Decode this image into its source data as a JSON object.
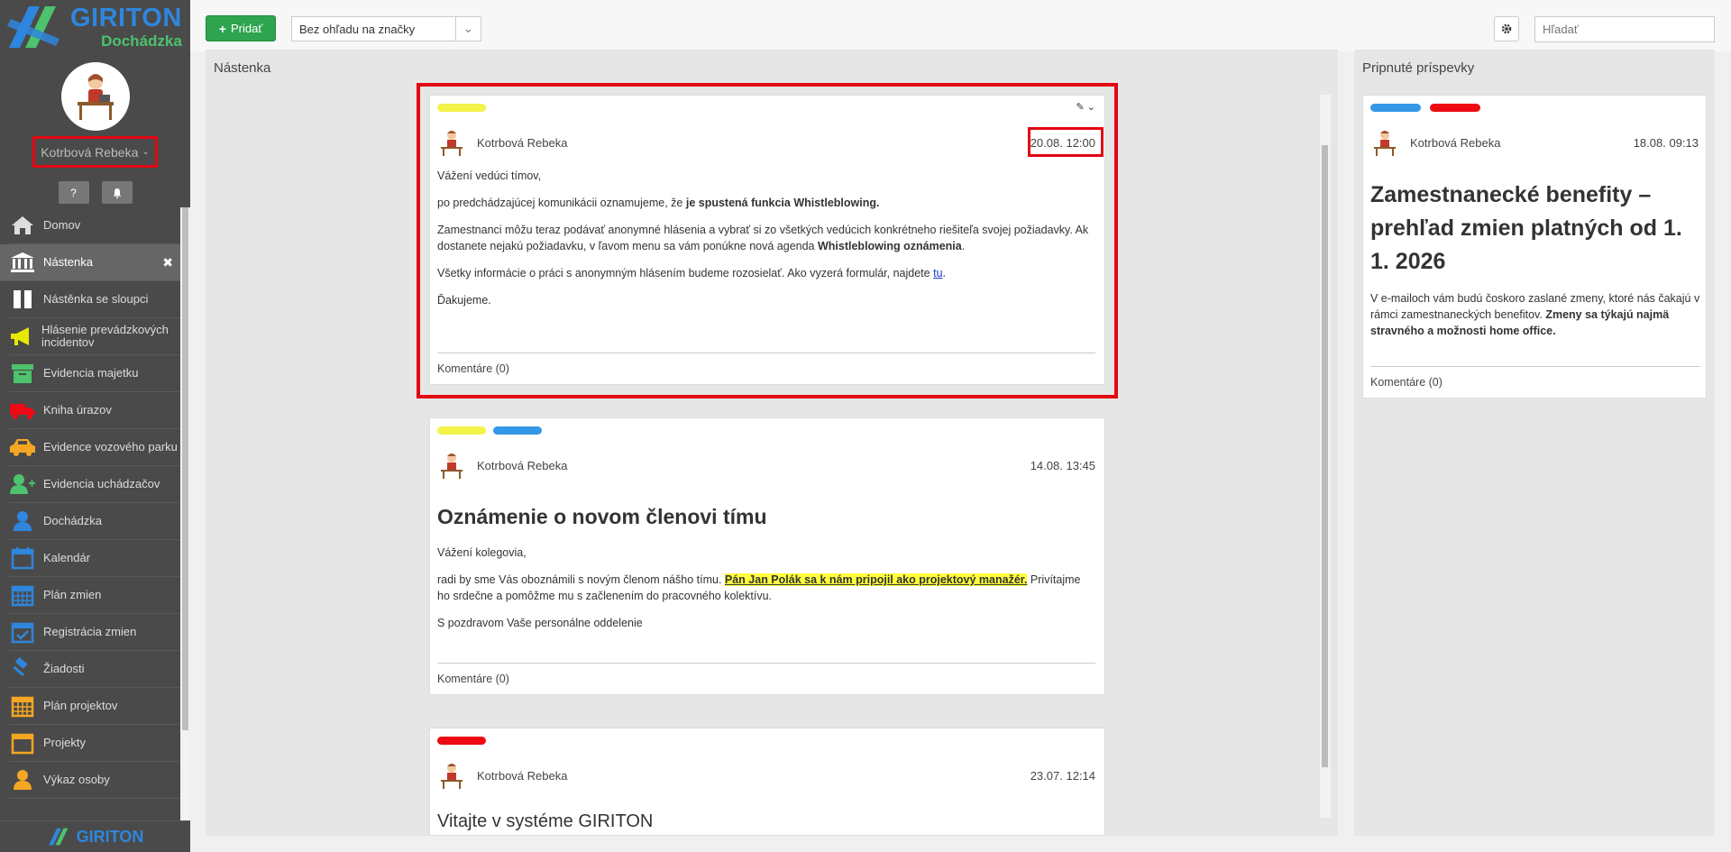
{
  "app": {
    "brand": "GIRITON",
    "subtitle": "Dochádzka",
    "footer_brand": "GIRITON"
  },
  "colors": {
    "sidebar_bg": "#4a4a4a",
    "primary": "#2e86de",
    "success": "#2ea44f",
    "highlight": "#e30613",
    "tag_yellow": "#f3f34a",
    "tag_blue": "#3399e6",
    "tag_red": "#ee0a14"
  },
  "user": {
    "name": "Kotrbová Rebeka"
  },
  "sidebar": {
    "items": [
      {
        "label": "Domov",
        "icon": "home-icon"
      },
      {
        "label": "Nástenka",
        "icon": "bank-icon",
        "active": true
      },
      {
        "label": "Nástěnka se sloupci",
        "icon": "columns-icon"
      },
      {
        "label": "Hlásenie prevádzkových incidentov",
        "icon": "megaphone-icon"
      },
      {
        "label": "Evidencia majetku",
        "icon": "archive-icon"
      },
      {
        "label": "Kniha úrazov",
        "icon": "ambulance-icon"
      },
      {
        "label": "Evidence vozového parku",
        "icon": "car-icon"
      },
      {
        "label": "Evidencia uchádzačov",
        "icon": "user-plus-icon"
      },
      {
        "label": "Dochádzka",
        "icon": "user-icon"
      },
      {
        "label": "Kalendár",
        "icon": "calendar-icon"
      },
      {
        "label": "Plán zmien",
        "icon": "calendar-grid-icon"
      },
      {
        "label": "Registrácia zmien",
        "icon": "calendar-check-icon"
      },
      {
        "label": "Žiadosti",
        "icon": "gavel-icon"
      },
      {
        "label": "Plán projektov",
        "icon": "calendar-orange-icon"
      },
      {
        "label": "Projekty",
        "icon": "calendar-blank-icon"
      },
      {
        "label": "Výkaz osoby",
        "icon": "person-orange-icon"
      }
    ]
  },
  "topbar": {
    "add_label": "Pridať",
    "tag_filter_value": "Bez ohľadu na značky",
    "search_placeholder": "Hľadať"
  },
  "board": {
    "title": "Nástenka",
    "posts": [
      {
        "author": "Kotrbová Rebeka",
        "date": "20.08. 12:00",
        "greeting": "Vážení vedúci tímov,",
        "p1_a": "po predchádzajúcej komunikácii oznamujeme, že ",
        "p1_b": "je spustená funkcia Whistleblowing.",
        "p2_a": "Zamestnanci môžu teraz podávať anonymné hlásenia a vybrať si zo všetkých vedúcich konkrétneho riešiteľa svojej požiadavky. Ak dostanete nejakú požiadavku, v ľavom menu sa vám ponúkne nová agenda ",
        "p2_b": "Whistleblowing oznámenia",
        "p2_c": ".",
        "p3_a": "Všetky informácie o práci s anonymným hlásením budeme rozosielať. Ako vyzerá formulár, najdete ",
        "p3_link": "tu",
        "p3_c": ".",
        "closing": "Ďakujeme.",
        "comments": "Komentáre (0)"
      },
      {
        "author": "Kotrbová Rebeka",
        "date": "14.08. 13:45",
        "heading": "Oznámenie o novom členovi tímu",
        "greeting": "Vážení kolegovia,",
        "p1_a": "radi by sme Vás oboznámili s novým členom nášho tímu. ",
        "p1_hl": "Pán Jan Polák sa k nám pripojil ako projektový manažér.",
        "p1_c": " Privítajme ho srdečne a pomôžme mu s začlenením do pracovného kolektívu.",
        "closing": "S pozdravom Vaše personálne oddelenie",
        "comments": "Komentáre (0)"
      },
      {
        "author": "Kotrbová Rebeka",
        "date": "23.07. 12:14",
        "heading": "Vitajte v systéme GIRITON"
      }
    ]
  },
  "pinned": {
    "title": "Pripnuté príspevky",
    "post": {
      "author": "Kotrbová Rebeka",
      "date": "18.08. 09:13",
      "heading": "Zamestnanecké benefity – prehľad zmien platných od 1. 1. 2026",
      "body_a": "V e-mailoch vám budú čoskoro zaslané zmeny, ktoré nás čakajú v rámci zamestnaneckých benefitov. ",
      "body_b": "Zmeny sa týkajú najmä stravného a možnosti home office.",
      "comments": "Komentáre (0)"
    }
  }
}
